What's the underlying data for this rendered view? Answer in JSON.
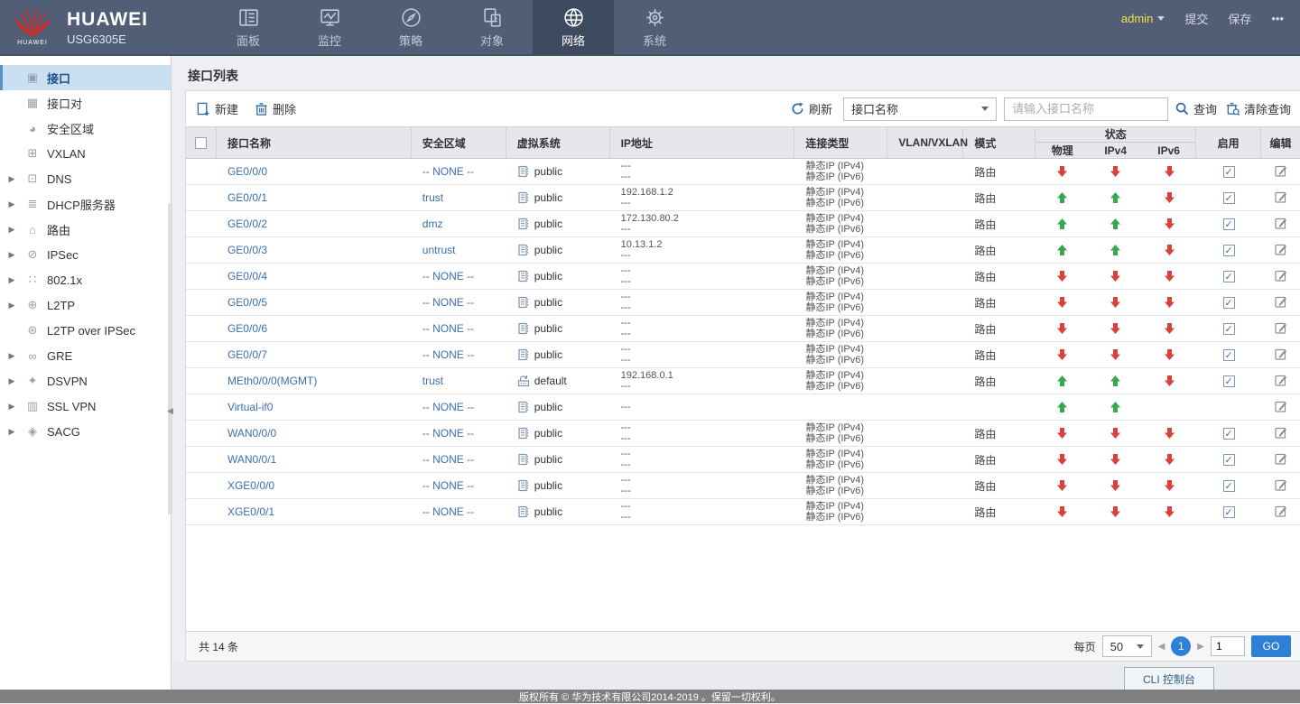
{
  "brand": {
    "logo_caption": "HUAWEI",
    "name": "HUAWEI",
    "model": "USG6305E",
    "logo_color": "#e2231a"
  },
  "topnav": {
    "tabs": [
      {
        "label": "面板",
        "icon": "dashboard-icon",
        "active": false
      },
      {
        "label": "监控",
        "icon": "monitor-icon",
        "active": false
      },
      {
        "label": "策略",
        "icon": "policy-icon",
        "active": false
      },
      {
        "label": "对象",
        "icon": "object-icon",
        "active": false
      },
      {
        "label": "网络",
        "icon": "network-icon",
        "active": true
      },
      {
        "label": "系统",
        "icon": "system-icon",
        "active": false
      }
    ],
    "user": "admin",
    "actions": [
      "提交",
      "保存",
      "•••"
    ]
  },
  "sidebar": {
    "items": [
      {
        "label": "接口",
        "icon": "interface-icon",
        "expandable": false,
        "selected": true
      },
      {
        "label": "接口对",
        "icon": "interface-pair-icon",
        "expandable": false,
        "selected": false
      },
      {
        "label": "安全区域",
        "icon": "security-zone-icon",
        "expandable": false,
        "selected": false
      },
      {
        "label": "VXLAN",
        "icon": "vxlan-icon",
        "expandable": false,
        "selected": false
      },
      {
        "label": "DNS",
        "icon": "dns-icon",
        "expandable": true,
        "selected": false
      },
      {
        "label": "DHCP服务器",
        "icon": "dhcp-server-icon",
        "expandable": true,
        "selected": false
      },
      {
        "label": "路由",
        "icon": "route-icon",
        "expandable": true,
        "selected": false
      },
      {
        "label": "IPSec",
        "icon": "ipsec-icon",
        "expandable": true,
        "selected": false
      },
      {
        "label": "802.1x",
        "icon": "dot1x-icon",
        "expandable": true,
        "selected": false
      },
      {
        "label": "L2TP",
        "icon": "l2tp-icon",
        "expandable": true,
        "selected": false
      },
      {
        "label": "L2TP over IPSec",
        "icon": "l2tp-ipsec-icon",
        "expandable": false,
        "selected": false
      },
      {
        "label": "GRE",
        "icon": "gre-icon",
        "expandable": true,
        "selected": false
      },
      {
        "label": "DSVPN",
        "icon": "dsvpn-icon",
        "expandable": true,
        "selected": false
      },
      {
        "label": "SSL VPN",
        "icon": "ssl-vpn-icon",
        "expandable": true,
        "selected": false
      },
      {
        "label": "SACG",
        "icon": "sacg-icon",
        "expandable": true,
        "selected": false
      }
    ]
  },
  "main": {
    "title": "接口列表",
    "toolbar": {
      "new_label": "新建",
      "delete_label": "删除",
      "refresh_label": "刷新",
      "filter_selected": "接口名称",
      "search_placeholder": "请输入接口名称",
      "query_label": "查询",
      "clear_label": "清除查询"
    },
    "table": {
      "headers": {
        "name": "接口名称",
        "zone": "安全区域",
        "vsys": "虚拟系统",
        "ip": "IP地址",
        "conn": "连接类型",
        "vlan": "VLAN/VXLAN",
        "mode": "模式",
        "status": "状态",
        "phy": "物理",
        "ipv4": "IPv4",
        "ipv6": "IPv6",
        "enable": "启用",
        "edit": "编辑"
      },
      "status_colors": {
        "up": "#36a94c",
        "down": "#d8413c"
      },
      "rows": [
        {
          "name": "GE0/0/0",
          "zone": "-- NONE --",
          "vsys": "public",
          "vsys_icon": "vsys-public-icon",
          "ip": [
            "---",
            "---"
          ],
          "conn": [
            "静态IP (IPv4)",
            "静态IP (IPv6)"
          ],
          "vlan": "",
          "mode": "路由",
          "phy": "down",
          "ipv4": "down",
          "ipv6": "down",
          "enabled": true,
          "editable": true
        },
        {
          "name": "GE0/0/1",
          "zone": "trust",
          "vsys": "public",
          "vsys_icon": "vsys-public-icon",
          "ip": [
            "192.168.1.2",
            "---"
          ],
          "conn": [
            "静态IP (IPv4)",
            "静态IP (IPv6)"
          ],
          "vlan": "",
          "mode": "路由",
          "phy": "up",
          "ipv4": "up",
          "ipv6": "down",
          "enabled": true,
          "editable": true
        },
        {
          "name": "GE0/0/2",
          "zone": "dmz",
          "vsys": "public",
          "vsys_icon": "vsys-public-icon",
          "ip": [
            "172.130.80.2",
            "---"
          ],
          "conn": [
            "静态IP (IPv4)",
            "静态IP (IPv6)"
          ],
          "vlan": "",
          "mode": "路由",
          "phy": "up",
          "ipv4": "up",
          "ipv6": "down",
          "enabled": true,
          "editable": true
        },
        {
          "name": "GE0/0/3",
          "zone": "untrust",
          "vsys": "public",
          "vsys_icon": "vsys-public-icon",
          "ip": [
            "10.13.1.2",
            "---"
          ],
          "conn": [
            "静态IP (IPv4)",
            "静态IP (IPv6)"
          ],
          "vlan": "",
          "mode": "路由",
          "phy": "up",
          "ipv4": "up",
          "ipv6": "down",
          "enabled": true,
          "editable": true
        },
        {
          "name": "GE0/0/4",
          "zone": "-- NONE --",
          "vsys": "public",
          "vsys_icon": "vsys-public-icon",
          "ip": [
            "---",
            "---"
          ],
          "conn": [
            "静态IP (IPv4)",
            "静态IP (IPv6)"
          ],
          "vlan": "",
          "mode": "路由",
          "phy": "down",
          "ipv4": "down",
          "ipv6": "down",
          "enabled": true,
          "editable": true
        },
        {
          "name": "GE0/0/5",
          "zone": "-- NONE --",
          "vsys": "public",
          "vsys_icon": "vsys-public-icon",
          "ip": [
            "---",
            "---"
          ],
          "conn": [
            "静态IP (IPv4)",
            "静态IP (IPv6)"
          ],
          "vlan": "",
          "mode": "路由",
          "phy": "down",
          "ipv4": "down",
          "ipv6": "down",
          "enabled": true,
          "editable": true
        },
        {
          "name": "GE0/0/6",
          "zone": "-- NONE --",
          "vsys": "public",
          "vsys_icon": "vsys-public-icon",
          "ip": [
            "---",
            "---"
          ],
          "conn": [
            "静态IP (IPv4)",
            "静态IP (IPv6)"
          ],
          "vlan": "",
          "mode": "路由",
          "phy": "down",
          "ipv4": "down",
          "ipv6": "down",
          "enabled": true,
          "editable": true
        },
        {
          "name": "GE0/0/7",
          "zone": "-- NONE --",
          "vsys": "public",
          "vsys_icon": "vsys-public-icon",
          "ip": [
            "---",
            "---"
          ],
          "conn": [
            "静态IP (IPv4)",
            "静态IP (IPv6)"
          ],
          "vlan": "",
          "mode": "路由",
          "phy": "down",
          "ipv4": "down",
          "ipv6": "down",
          "enabled": true,
          "editable": true
        },
        {
          "name": "MEth0/0/0(MGMT)",
          "zone": "trust",
          "vsys": "default",
          "vsys_icon": "vsys-default-icon",
          "ip": [
            "192.168.0.1",
            "---"
          ],
          "conn": [
            "静态IP (IPv4)",
            "静态IP (IPv6)"
          ],
          "vlan": "",
          "mode": "路由",
          "phy": "up",
          "ipv4": "up",
          "ipv6": "down",
          "enabled": true,
          "editable": true
        },
        {
          "name": "Virtual-if0",
          "zone": "-- NONE --",
          "vsys": "public",
          "vsys_icon": "vsys-public-icon",
          "ip": [
            "---"
          ],
          "conn": [],
          "vlan": "",
          "mode": "",
          "phy": "up",
          "ipv4": "up",
          "ipv6": "",
          "enabled": null,
          "editable": true
        },
        {
          "name": "WAN0/0/0",
          "zone": "-- NONE --",
          "vsys": "public",
          "vsys_icon": "vsys-public-icon",
          "ip": [
            "---",
            "---"
          ],
          "conn": [
            "静态IP (IPv4)",
            "静态IP (IPv6)"
          ],
          "vlan": "",
          "mode": "路由",
          "phy": "down",
          "ipv4": "down",
          "ipv6": "down",
          "enabled": true,
          "editable": true
        },
        {
          "name": "WAN0/0/1",
          "zone": "-- NONE --",
          "vsys": "public",
          "vsys_icon": "vsys-public-icon",
          "ip": [
            "---",
            "---"
          ],
          "conn": [
            "静态IP (IPv4)",
            "静态IP (IPv6)"
          ],
          "vlan": "",
          "mode": "路由",
          "phy": "down",
          "ipv4": "down",
          "ipv6": "down",
          "enabled": true,
          "editable": true
        },
        {
          "name": "XGE0/0/0",
          "zone": "-- NONE --",
          "vsys": "public",
          "vsys_icon": "vsys-public-icon",
          "ip": [
            "---",
            "---"
          ],
          "conn": [
            "静态IP (IPv4)",
            "静态IP (IPv6)"
          ],
          "vlan": "",
          "mode": "路由",
          "phy": "down",
          "ipv4": "down",
          "ipv6": "down",
          "enabled": true,
          "editable": true
        },
        {
          "name": "XGE0/0/1",
          "zone": "-- NONE --",
          "vsys": "public",
          "vsys_icon": "vsys-public-icon",
          "ip": [
            "---",
            "---"
          ],
          "conn": [
            "静态IP (IPv4)",
            "静态IP (IPv6)"
          ],
          "vlan": "",
          "mode": "路由",
          "phy": "down",
          "ipv4": "down",
          "ipv6": "down",
          "enabled": true,
          "editable": true
        }
      ]
    },
    "footer": {
      "total": "共 14 条",
      "per_page_label": "每页",
      "per_page": "50",
      "current_page": "1",
      "goto_value": "1",
      "go_label": "GO"
    }
  },
  "bottom": {
    "cli_label": "CLI 控制台",
    "copyright": "版权所有 © 华为技术有限公司2014-2019 。保留一切权利。"
  }
}
